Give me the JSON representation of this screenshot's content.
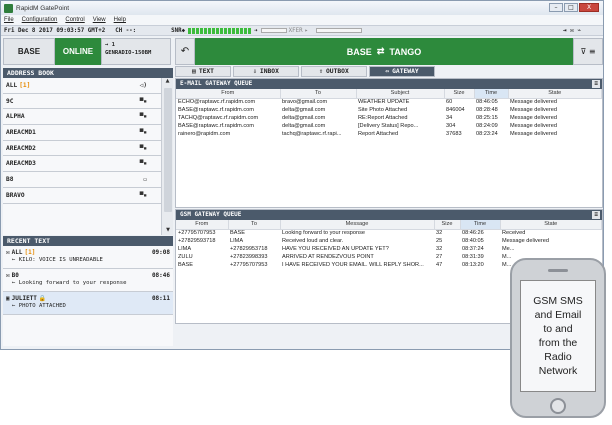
{
  "window": {
    "title": "RapidM GatePoint",
    "ctrl_min": "–",
    "ctrl_max": "□",
    "ctrl_close": "X"
  },
  "menu": [
    "File",
    "Configuration",
    "Control",
    "View",
    "Help"
  ],
  "status": {
    "datetime": "Fri Dec 8 2017 09:03:57 GMT+2",
    "ch": "CH --:",
    "snr": "SNR",
    "xfer": "XFER"
  },
  "station": {
    "name": "BASE",
    "state": "ONLINE",
    "count": "→ 1",
    "modem": "GENRADIO-150BM"
  },
  "address_book": {
    "header": "ADDRESS BOOK",
    "items": [
      {
        "name": "ALL",
        "count": "[1]",
        "icon": "broadcast-icon"
      },
      {
        "name": "9C",
        "icon": "radio-icon"
      },
      {
        "name": "ALPHA",
        "icon": "radio-icon"
      },
      {
        "name": "AREACMD1",
        "icon": "radio-icon"
      },
      {
        "name": "AREACMD2",
        "icon": "radio-icon"
      },
      {
        "name": "AREACMD3",
        "icon": "radio-icon"
      },
      {
        "name": "B8",
        "icon": "mobile-icon"
      },
      {
        "name": "BRAVO",
        "icon": "radio-icon"
      }
    ]
  },
  "recent_text": {
    "header": "RECENT TEXT",
    "items": [
      {
        "from": "ALL",
        "count": "[1]",
        "time": "09:08",
        "body": "← KILO: VOICE IS UNREADABLE"
      },
      {
        "from": "B0",
        "time": "08:46",
        "body": "← Looking forward to your response"
      },
      {
        "from": "JULIETT",
        "time": "08:11",
        "body": "← PHOTO ATTACHED"
      }
    ]
  },
  "route": {
    "from": "BASE",
    "to": "TANGO"
  },
  "tabs": [
    {
      "label": "TEXT",
      "active": false
    },
    {
      "label": "INBOX",
      "active": false
    },
    {
      "label": "OUTBOX",
      "active": false
    },
    {
      "label": "GATEWAY",
      "active": true
    }
  ],
  "email_queue": {
    "title": "E-MAIL GATEWAY QUEUE",
    "columns": [
      "From",
      "To",
      "Subject",
      "Size",
      "Time",
      "State"
    ],
    "rows": [
      [
        "ECHO@raptawc.rf.rapidm.com",
        "bravo@gmail.com",
        "WEATHER UPDATE",
        "60",
        "08:46:05",
        "Message delivered"
      ],
      [
        "BASE@raptawc.rf.rapidm.com",
        "delta@gmail.com",
        "Site Photo Attached",
        "846004",
        "08:28:48",
        "Message delivered"
      ],
      [
        "TACHQ@raptawc.rf.rapidm.com",
        "delta@gmail.com",
        "RE:Report Attached",
        "34",
        "08:25:15",
        "Message delivered"
      ],
      [
        "BASE@raptawc.rf.rapidm.com",
        "delta@gmail.com",
        "[Delivery Status] Repo...",
        "304",
        "08:24:09",
        "Message delivered"
      ],
      [
        "rainero@rapidm.com",
        "tachq@raptawc.rf.rapi...",
        "Report Attached",
        "37683",
        "08:23:24",
        "Message delivered"
      ]
    ]
  },
  "gsm_queue": {
    "title": "GSM GATEWAY QUEUE",
    "columns": [
      "From",
      "To",
      "Message",
      "Size",
      "Time",
      "State"
    ],
    "rows": [
      [
        "+27795707953",
        "BASE",
        "Looking forward to your response",
        "32",
        "08:46:26",
        "Received"
      ],
      [
        "+27829593718",
        "LIMA",
        "Received loud and clear.",
        "25",
        "08:40:05",
        "Message delivered"
      ],
      [
        "LIMA",
        "+27829953718",
        "HAVE YOU RECEIVED AN UPDATE YET?",
        "32",
        "08:37:24",
        "Me..."
      ],
      [
        "ZULU",
        "+27823998393",
        "ARRIVED AT RENDEZVOUS POINT",
        "27",
        "08:31:39",
        "M..."
      ],
      [
        "BASE",
        "+27795707953",
        "I HAVE RECEIVED YOUR EMAIL. WILL REPLY SHOR...",
        "47",
        "08:13:20",
        "M..."
      ]
    ]
  },
  "callout": {
    "lines": [
      "GSM SMS",
      "and Email",
      "to and",
      "from the",
      "Radio",
      "Network"
    ]
  },
  "colors": {
    "accent_green": "#2d8a3c",
    "header_slate": "#4b5a6b",
    "count_orange": "#e68a00"
  }
}
